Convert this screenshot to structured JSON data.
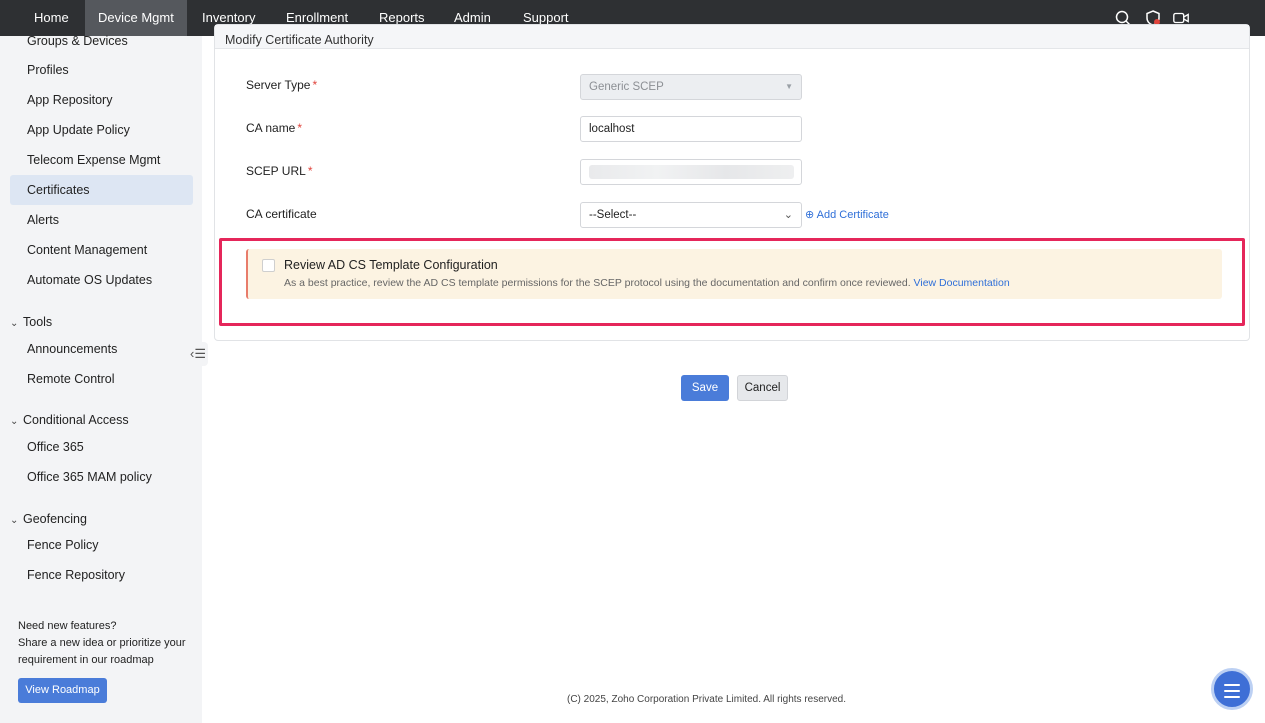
{
  "topnav": {
    "items": [
      "Home",
      "Device Mgmt",
      "Inventory",
      "Enrollment",
      "Reports",
      "Admin",
      "Support"
    ],
    "active": "Device Mgmt",
    "icons": [
      "search-icon",
      "shield-alert-icon",
      "video-call-icon"
    ],
    "bg_color": "#2e3033"
  },
  "sidebar": {
    "items": [
      "Groups & Devices",
      "Profiles",
      "App Repository",
      "App Update Policy",
      "Telecom Expense Mgmt",
      "Certificates",
      "Alerts",
      "Content Management",
      "Automate OS Updates"
    ],
    "active": "Certificates",
    "groups": [
      {
        "label": "Tools",
        "items": [
          "Announcements",
          "Remote Control"
        ]
      },
      {
        "label": "Conditional Access",
        "items": [
          "Office 365",
          "Office 365 MAM policy"
        ]
      },
      {
        "label": "Geofencing",
        "items": [
          "Fence Policy",
          "Fence Repository"
        ]
      }
    ],
    "promo": {
      "title": "Need new features?",
      "line1": "Share a new idea or prioritize your",
      "line2": "requirement in our roadmap",
      "button": "View Roadmap"
    }
  },
  "form": {
    "title": "Modify Certificate Authority",
    "server_type": {
      "label": "Server Type",
      "value": "Generic SCEP"
    },
    "ca_name": {
      "label": "CA name",
      "value": "localhost"
    },
    "scep_url": {
      "label": "SCEP URL"
    },
    "ca_certificate": {
      "label": "CA certificate",
      "value": "--Select--",
      "add_label": "Add Certificate"
    },
    "required_mark": "*"
  },
  "notice": {
    "title": "Review AD CS Template Configuration",
    "text": "As a best practice, review the AD CS template permissions for the SCEP protocol using the documentation and confirm once reviewed.",
    "link": "View Documentation"
  },
  "actions": {
    "save": "Save",
    "cancel": "Cancel"
  },
  "footer": "(C) 2025, Zoho Corporation Private Limited. All rights reserved.",
  "colors": {
    "accent": "#4a7cd9",
    "highlight_border": "#e5265a",
    "notice_bg": "#fcf3e2",
    "required": "#e0433b"
  }
}
